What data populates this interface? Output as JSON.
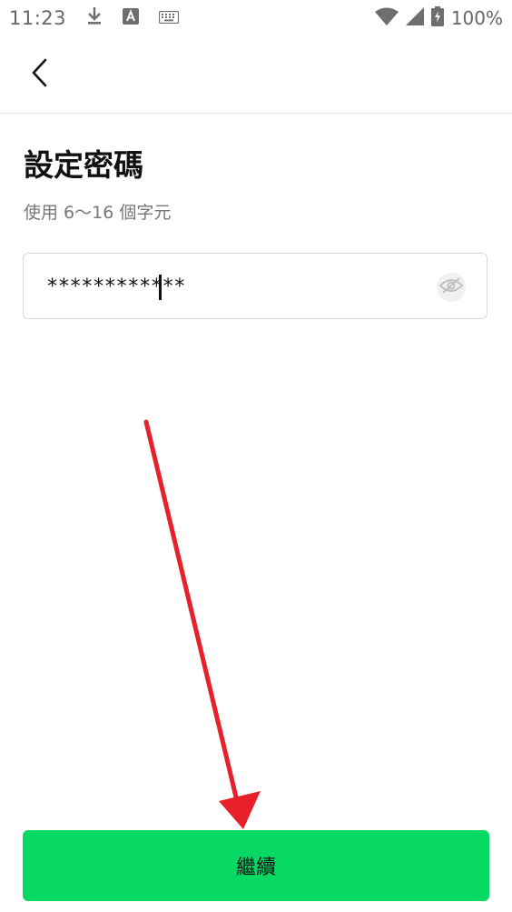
{
  "status_bar": {
    "time": "11:23",
    "battery_percent": "100%",
    "icons": [
      "download-icon",
      "text-a-icon",
      "keyboard-icon",
      "wifi-icon",
      "cellular-signal-icon",
      "battery-charging-icon"
    ]
  },
  "header": {
    "back_icon": "chevron-left-icon"
  },
  "page": {
    "title": "設定密碼",
    "subtitle": "使用 6～16 個字元"
  },
  "password_field": {
    "value": "************",
    "visibility_icon": "eye-slash-icon"
  },
  "continue_button": {
    "label": "繼續"
  },
  "colors": {
    "primary_green": "#06d863",
    "annotation_red": "#e8202a"
  }
}
